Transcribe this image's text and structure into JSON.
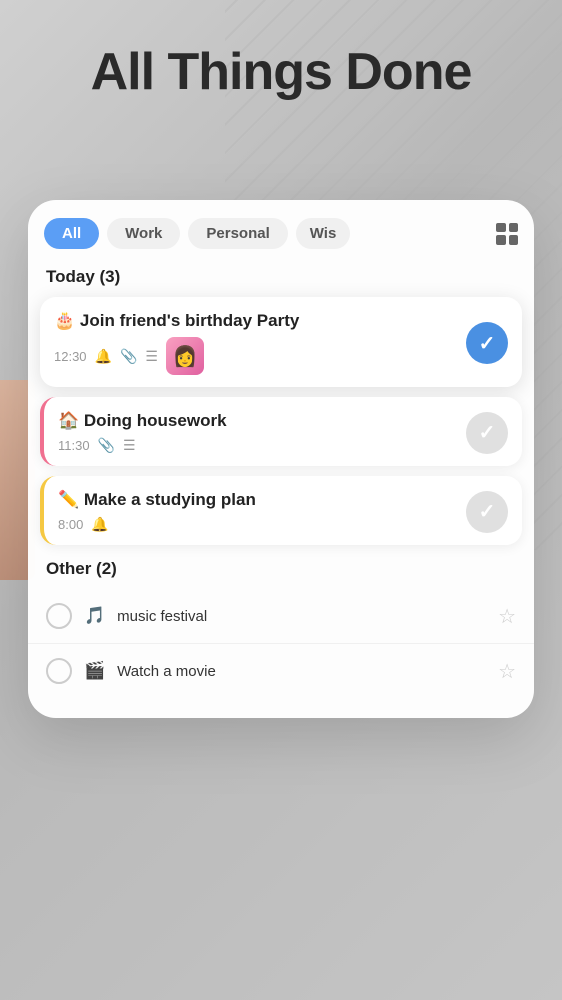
{
  "app": {
    "title": "All Things Done",
    "background_color": "#c8c8c8"
  },
  "filters": {
    "items": [
      {
        "label": "All",
        "active": true
      },
      {
        "label": "Work",
        "active": false
      },
      {
        "label": "Personal",
        "active": false
      },
      {
        "label": "Wis",
        "active": false
      }
    ],
    "grid_icon": "grid-icon"
  },
  "today_section": {
    "header": "Today (3)",
    "tasks": [
      {
        "id": 1,
        "emoji": "🎂",
        "title": "Join friend's birthday Party",
        "time": "12:30",
        "has_bell": true,
        "has_attachment": true,
        "has_list": true,
        "has_thumb": true,
        "thumb_emoji": "👩",
        "completed": true,
        "border_color": "none"
      },
      {
        "id": 2,
        "emoji": "🏠",
        "title": "Doing housework",
        "time": "11:30",
        "has_bell": false,
        "has_attachment": true,
        "has_list": true,
        "has_thumb": false,
        "completed": false,
        "border_color": "pink"
      },
      {
        "id": 3,
        "emoji": "✏️",
        "title": "Make a studying plan",
        "time": "8:00",
        "has_bell": true,
        "has_attachment": false,
        "has_list": false,
        "has_thumb": false,
        "completed": false,
        "border_color": "yellow"
      }
    ]
  },
  "other_section": {
    "header": "Other (2)",
    "tasks": [
      {
        "id": 1,
        "icon": "🎵",
        "title": "music festival",
        "starred": false
      },
      {
        "id": 2,
        "icon": "🎬",
        "title": "Watch a movie",
        "starred": false
      }
    ]
  }
}
